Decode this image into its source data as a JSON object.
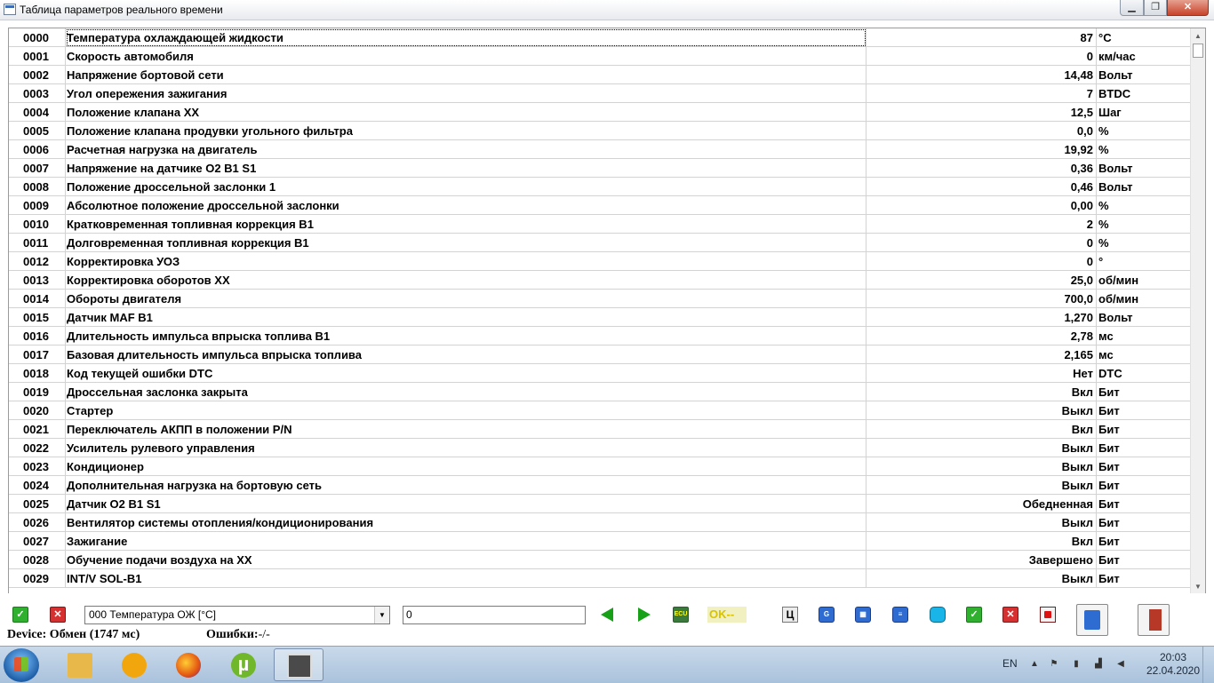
{
  "window": {
    "title": "Таблица параметров реального времени"
  },
  "rows": [
    {
      "code": "0000",
      "name": "Температура охлаждающей жидкости",
      "value": "87",
      "unit": "°C"
    },
    {
      "code": "0001",
      "name": "Скорость автомобиля",
      "value": "0",
      "unit": "км/час"
    },
    {
      "code": "0002",
      "name": "Напряжение бортовой сети",
      "value": "14,48",
      "unit": "Вольт"
    },
    {
      "code": "0003",
      "name": "Угол опережения зажигания",
      "value": "7",
      "unit": "BTDC"
    },
    {
      "code": "0004",
      "name": "Положение клапана ХХ",
      "value": "12,5",
      "unit": "Шаг"
    },
    {
      "code": "0005",
      "name": "Положение клапана продувки угольного фильтра",
      "value": "0,0",
      "unit": "%"
    },
    {
      "code": "0006",
      "name": "Расчетная нагрузка на двигатель",
      "value": "19,92",
      "unit": "%"
    },
    {
      "code": "0007",
      "name": "Напряжение на датчике O2 B1 S1",
      "value": "0,36",
      "unit": "Вольт"
    },
    {
      "code": "0008",
      "name": "Положение дроссельной заслонки 1",
      "value": "0,46",
      "unit": "Вольт"
    },
    {
      "code": "0009",
      "name": "Абсолютное положение дроссельной заслонки",
      "value": "0,00",
      "unit": "%"
    },
    {
      "code": "0010",
      "name": "Кратковременная топливная коррекция B1",
      "value": "2",
      "unit": "%"
    },
    {
      "code": "0011",
      "name": "Долговременная топливная коррекция B1",
      "value": "0",
      "unit": "%"
    },
    {
      "code": "0012",
      "name": "Корректировка УОЗ",
      "value": "0",
      "unit": "°"
    },
    {
      "code": "0013",
      "name": "Корректировка оборотов ХХ",
      "value": "25,0",
      "unit": "об/мин"
    },
    {
      "code": "0014",
      "name": "Обороты двигателя",
      "value": "700,0",
      "unit": "об/мин"
    },
    {
      "code": "0015",
      "name": "Датчик MAF B1",
      "value": "1,270",
      "unit": "Вольт"
    },
    {
      "code": "0016",
      "name": "Длительность импульса впрыска топлива B1",
      "value": "2,78",
      "unit": "мс"
    },
    {
      "code": "0017",
      "name": "Базовая длительность импульса впрыска топлива",
      "value": "2,165",
      "unit": "мс"
    },
    {
      "code": "0018",
      "name": "Код текущей ошибки DTC",
      "value": "Нет",
      "unit": "DTC"
    },
    {
      "code": "0019",
      "name": "Дроссельная заслонка закрыта",
      "value": "Вкл",
      "unit": "Бит"
    },
    {
      "code": "0020",
      "name": "Стартер",
      "value": "Выкл",
      "unit": "Бит"
    },
    {
      "code": "0021",
      "name": "Переключатель АКПП в положении P/N",
      "value": "Вкл",
      "unit": "Бит"
    },
    {
      "code": "0022",
      "name": "Усилитель рулевого управления",
      "value": "Выкл",
      "unit": "Бит"
    },
    {
      "code": "0023",
      "name": "Кондиционер",
      "value": "Выкл",
      "unit": "Бит"
    },
    {
      "code": "0024",
      "name": "Дополнительная нагрузка на бортовую сеть",
      "value": "Выкл",
      "unit": "Бит"
    },
    {
      "code": "0025",
      "name": "Датчик O2 B1 S1",
      "value": "Обедненная",
      "unit": "Бит"
    },
    {
      "code": "0026",
      "name": "Вентилятор системы отопления/кондиционирования",
      "value": "Выкл",
      "unit": "Бит"
    },
    {
      "code": "0027",
      "name": "Зажигание",
      "value": "Вкл",
      "unit": "Бит"
    },
    {
      "code": "0028",
      "name": "Обучение подачи воздуха на ХХ",
      "value": "Завершено",
      "unit": "Бит"
    },
    {
      "code": "0029",
      "name": "INT/V SOL-B1",
      "value": "Выкл",
      "unit": "Бит"
    }
  ],
  "toolbar": {
    "param_select": "000 Температура ОЖ [°C]",
    "value_input": "0",
    "ok_label": "OK--",
    "c_label": "Ц",
    "ecu_label": "ECU"
  },
  "status": {
    "device": "Device: Обмен (1747 мс)",
    "errors_label": "Ошибки:",
    "errors_value": "-/-"
  },
  "taskbar": {
    "lang": "EN",
    "time": "20:03",
    "date": "22.04.2020",
    "utorrent_glyph": "µ"
  }
}
